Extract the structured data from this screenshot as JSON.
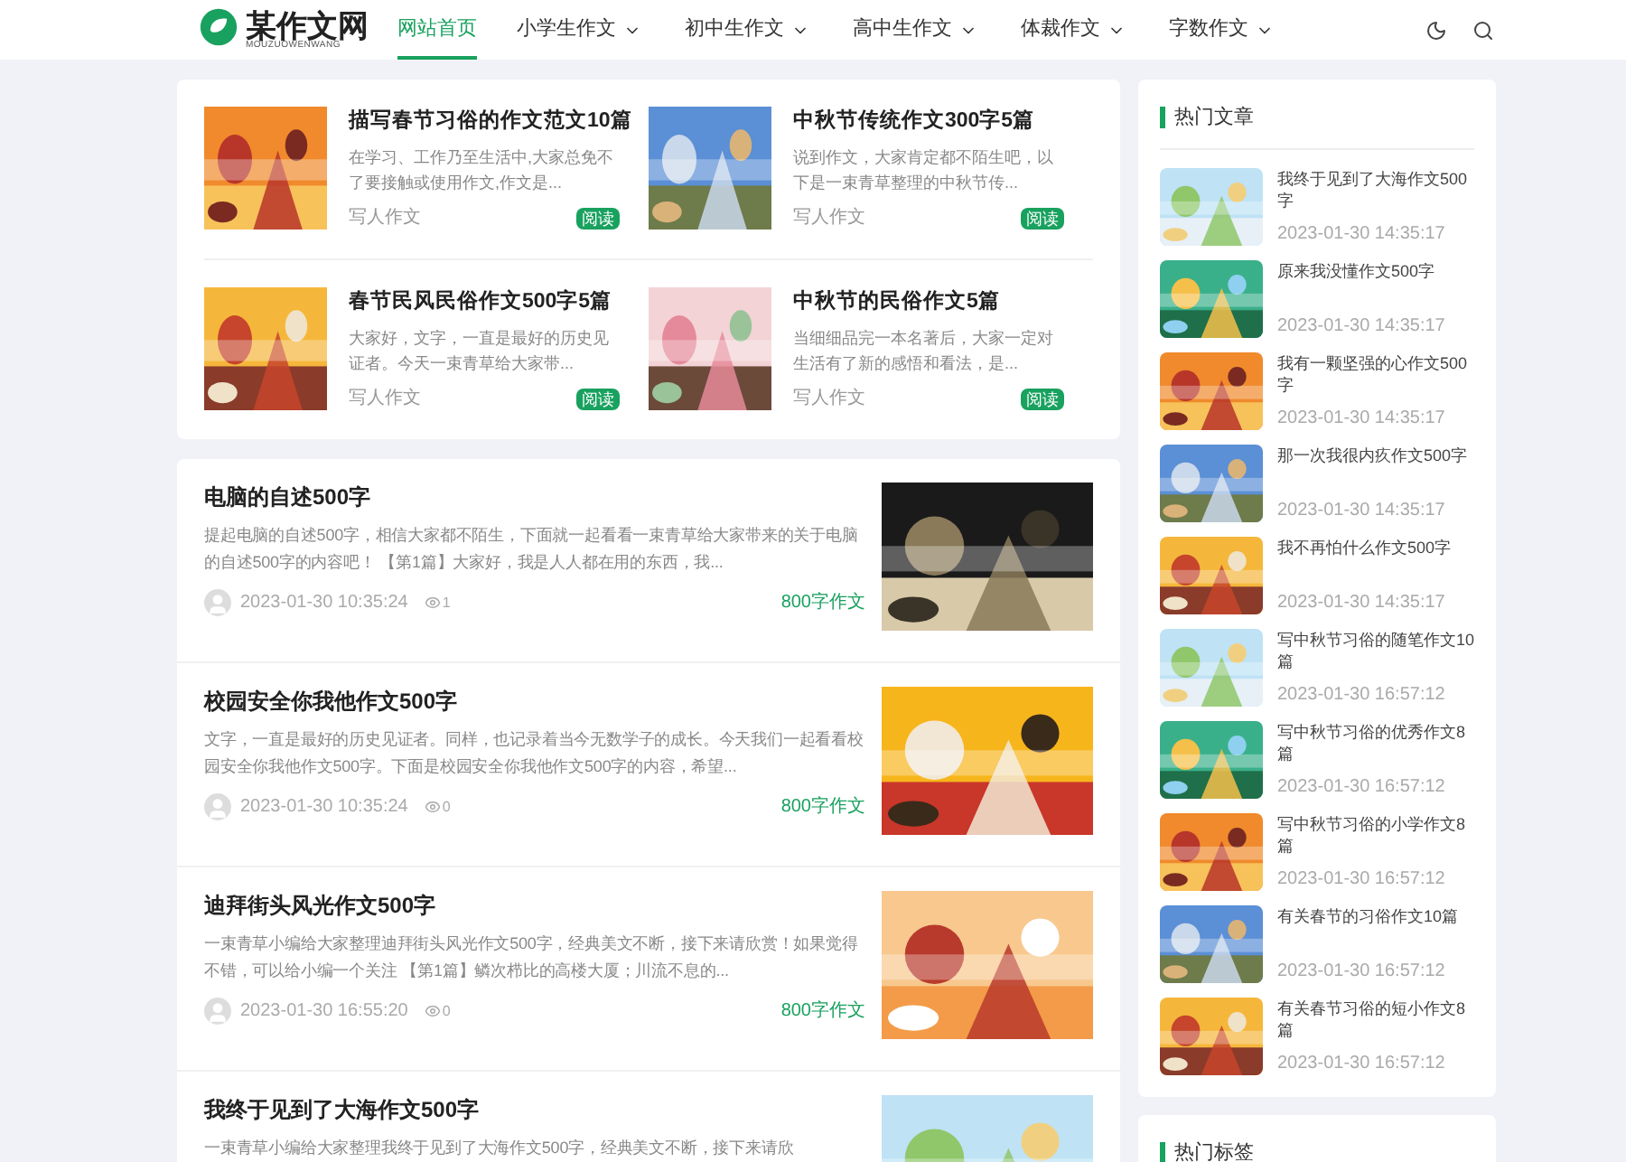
{
  "header": {
    "logo": {
      "name": "某作文网",
      "subtitle": "MOUZUOWENWANG"
    },
    "nav": [
      {
        "label": "网站首页",
        "selected": true,
        "dropdown": false
      },
      {
        "label": "小学生作文",
        "selected": false,
        "dropdown": true
      },
      {
        "label": "初中生作文",
        "selected": false,
        "dropdown": true
      },
      {
        "label": "高中生作文",
        "selected": false,
        "dropdown": true
      },
      {
        "label": "体裁作文",
        "selected": false,
        "dropdown": true
      },
      {
        "label": "字数作文",
        "selected": false,
        "dropdown": true
      }
    ]
  },
  "featured": [
    {
      "title": "描写春节习俗的作文范文10篇",
      "excerpt": "在学习、工作乃至生活中,大家总免不了要接触或使用作文,作文是...",
      "category": "写人作文",
      "button": "阅读"
    },
    {
      "title": "中秋节传统作文300字5篇",
      "excerpt": "说到作文，大家肯定都不陌生吧，以下是一束青草整理的中秋节传...",
      "category": "写人作文",
      "button": "阅读"
    },
    {
      "title": "春节民风民俗作文500字5篇",
      "excerpt": "大家好，文字，一直是最好的历史见证者。今天一束青草给大家带...",
      "category": "写人作文",
      "button": "阅读"
    },
    {
      "title": "中秋节的民俗作文5篇",
      "excerpt": "当细细品完一本名著后，大家一定对生活有了新的感悟和看法，是...",
      "category": "写人作文",
      "button": "阅读"
    }
  ],
  "articles": [
    {
      "title": "电脑的自述500字",
      "excerpt": "提起电脑的自述500字，相信大家都不陌生，下面就一起看看一束青草给大家带来的关于电脑的自述500字的内容吧！ 【第1篇】大家好，我是人人都在用的东西，我...",
      "date": "2023-01-30 10:35:24",
      "views": "1",
      "category": "800字作文"
    },
    {
      "title": "校园安全你我他作文500字",
      "excerpt": "文字，一直是最好的历史见证者。同样，也记录着当今无数学子的成长。今天我们一起看看校园安全你我他作文500字。下面是校园安全你我他作文500字的内容，希望...",
      "date": "2023-01-30 10:35:24",
      "views": "0",
      "category": "800字作文"
    },
    {
      "title": "迪拜街头风光作文500字",
      "excerpt": "一束青草小编给大家整理迪拜街头风光作文500字，经典美文不断，接下来请欣赏！如果觉得不错，可以给小编一个关注 【第1篇】鳞次栉比的高楼大厦；川流不息的...",
      "date": "2023-01-30 16:55:20",
      "views": "0",
      "category": "800字作文"
    },
    {
      "title": "我终于见到了大海作文500字",
      "excerpt": "一束青草小编给大家整理我终于见到了大海作文500字，经典美文不断，接下来请欣"
    }
  ],
  "sidebar": {
    "hot_articles": {
      "title": "热门文章",
      "items": [
        {
          "title": "我终于见到了大海作文500字",
          "date": "2023-01-30 14:35:17"
        },
        {
          "title": "原来我没懂作文500字",
          "date": "2023-01-30 14:35:17"
        },
        {
          "title": "我有一颗坚强的心作文500字",
          "date": "2023-01-30 14:35:17"
        },
        {
          "title": "那一次我很内疚作文500字",
          "date": "2023-01-30 14:35:17"
        },
        {
          "title": "我不再怕什么作文500字",
          "date": "2023-01-30 14:35:17"
        },
        {
          "title": "写中秋节习俗的随笔作文10篇",
          "date": "2023-01-30 16:57:12"
        },
        {
          "title": "写中秋节习俗的优秀作文8篇",
          "date": "2023-01-30 16:57:12"
        },
        {
          "title": "写中秋节习俗的小学作文8篇",
          "date": "2023-01-30 16:57:12"
        },
        {
          "title": "有关春节的习俗作文10篇",
          "date": "2023-01-30 16:57:12"
        },
        {
          "title": "有关春节习俗的短小作文8篇",
          "date": "2023-01-30 16:57:12"
        }
      ]
    },
    "hot_tags": {
      "title": "热门标签"
    }
  }
}
